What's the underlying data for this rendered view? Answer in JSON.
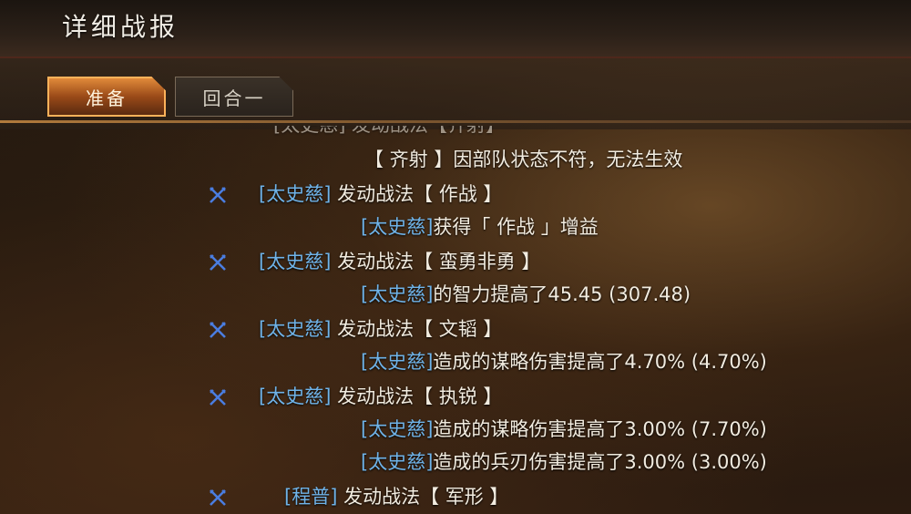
{
  "header": {
    "title": "详细战报"
  },
  "tabs": [
    {
      "label": "准备",
      "active": true
    },
    {
      "label": "回合一",
      "active": false
    }
  ],
  "log": {
    "cut_top_line": "[太史慈] 发动战法【齐射】",
    "lines": [
      {
        "kind": "detail",
        "prefix": "【 齐射 】因部队状态不符，无法生效",
        "name": "",
        "suffix": ""
      },
      {
        "kind": "action",
        "name": "[太史慈]",
        "suffix": " 发动战法【 作战 】"
      },
      {
        "kind": "detail",
        "prefix": "",
        "name": "[太史慈]",
        "suffix": "获得「 作战 」增益"
      },
      {
        "kind": "action",
        "name": "[太史慈]",
        "suffix": " 发动战法【 蛮勇非勇 】"
      },
      {
        "kind": "detail",
        "prefix": "",
        "name": "[太史慈]",
        "suffix": "的智力提高了45.45 (307.48)"
      },
      {
        "kind": "action",
        "name": "[太史慈]",
        "suffix": " 发动战法【 文韬 】"
      },
      {
        "kind": "detail",
        "prefix": "",
        "name": "[太史慈]",
        "suffix": "造成的谋略伤害提高了4.70% (4.70%)"
      },
      {
        "kind": "action",
        "name": "[太史慈]",
        "suffix": " 发动战法【 执锐 】"
      },
      {
        "kind": "detail",
        "prefix": "",
        "name": "[太史慈]",
        "suffix": "造成的谋略伤害提高了3.00% (7.70%)"
      },
      {
        "kind": "detail",
        "prefix": "",
        "name": "[太史慈]",
        "suffix": "造成的兵刃伤害提高了3.00% (3.00%)"
      },
      {
        "kind": "action",
        "name": "[程普]",
        "suffix": " 发动战法【 军形 】"
      }
    ]
  },
  "colors": {
    "name": "#6fb3e8",
    "text": "#f2ece0",
    "icon": "#4a7de0",
    "tab_active": "#e08a3a"
  },
  "icons": {
    "action": "crossed-swords-icon"
  }
}
